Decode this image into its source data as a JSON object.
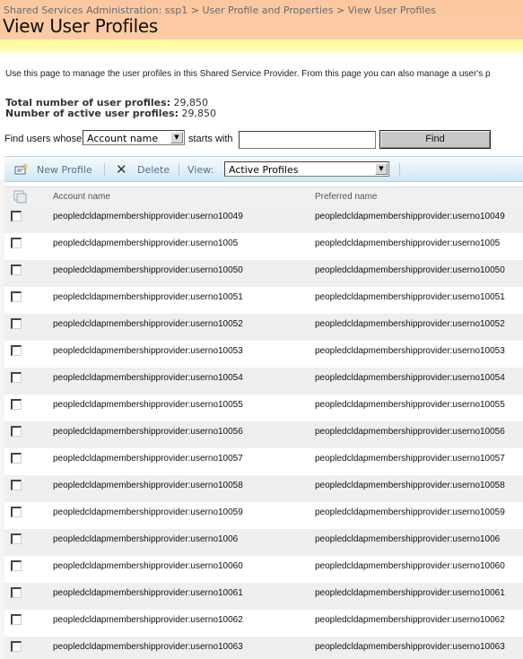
{
  "breadcrumb": {
    "items": [
      "Shared Services Administration: ssp1",
      "User Profile and Properties",
      "View User Profiles"
    ],
    "separator": ">"
  },
  "page": {
    "title": "View User Profiles",
    "description": "Use this page to manage the user profiles in this Shared Service Provider. From this page you can also manage a user's p"
  },
  "stats": {
    "total_label": "Total number of user profiles:",
    "total_value": "29,850",
    "active_label": "Number of active user profiles:",
    "active_value": "29,850"
  },
  "find": {
    "prefix_label": "Find users whose",
    "field_selected": "Account name",
    "middle_label": "starts with",
    "search_value": "",
    "button_label": "Find"
  },
  "toolbar": {
    "new_profile_label": "New Profile",
    "delete_label": "Delete",
    "view_label": "View:",
    "view_selected": "Active Profiles"
  },
  "table": {
    "columns": [
      "Account name",
      "Preferred name"
    ],
    "rows": [
      {
        "account": "peopledcldapmembershipprovider:userno10049",
        "preferred": "peopledcldapmembershipprovider:userno10049"
      },
      {
        "account": "peopledcldapmembershipprovider:userno1005",
        "preferred": "peopledcldapmembershipprovider:userno1005"
      },
      {
        "account": "peopledcldapmembershipprovider:userno10050",
        "preferred": "peopledcldapmembershipprovider:userno10050"
      },
      {
        "account": "peopledcldapmembershipprovider:userno10051",
        "preferred": "peopledcldapmembershipprovider:userno10051"
      },
      {
        "account": "peopledcldapmembershipprovider:userno10052",
        "preferred": "peopledcldapmembershipprovider:userno10052"
      },
      {
        "account": "peopledcldapmembershipprovider:userno10053",
        "preferred": "peopledcldapmembershipprovider:userno10053"
      },
      {
        "account": "peopledcldapmembershipprovider:userno10054",
        "preferred": "peopledcldapmembershipprovider:userno10054"
      },
      {
        "account": "peopledcldapmembershipprovider:userno10055",
        "preferred": "peopledcldapmembershipprovider:userno10055"
      },
      {
        "account": "peopledcldapmembershipprovider:userno10056",
        "preferred": "peopledcldapmembershipprovider:userno10056"
      },
      {
        "account": "peopledcldapmembershipprovider:userno10057",
        "preferred": "peopledcldapmembershipprovider:userno10057"
      },
      {
        "account": "peopledcldapmembershipprovider:userno10058",
        "preferred": "peopledcldapmembershipprovider:userno10058"
      },
      {
        "account": "peopledcldapmembershipprovider:userno10059",
        "preferred": "peopledcldapmembershipprovider:userno10059"
      },
      {
        "account": "peopledcldapmembershipprovider:userno1006",
        "preferred": "peopledcldapmembershipprovider:userno1006"
      },
      {
        "account": "peopledcldapmembershipprovider:userno10060",
        "preferred": "peopledcldapmembershipprovider:userno10060"
      },
      {
        "account": "peopledcldapmembershipprovider:userno10061",
        "preferred": "peopledcldapmembershipprovider:userno10061"
      },
      {
        "account": "peopledcldapmembershipprovider:userno10062",
        "preferred": "peopledcldapmembershipprovider:userno10062"
      },
      {
        "account": "peopledcldapmembershipprovider:userno10063",
        "preferred": "peopledcldapmembershipprovider:userno10063"
      }
    ]
  },
  "colors": {
    "title_band": "#fbc9a2",
    "yellow_band": "#fffba0",
    "toolbar": "#e3f1fa",
    "toolbar_text": "#56708a",
    "row_alt": "#efefef"
  }
}
